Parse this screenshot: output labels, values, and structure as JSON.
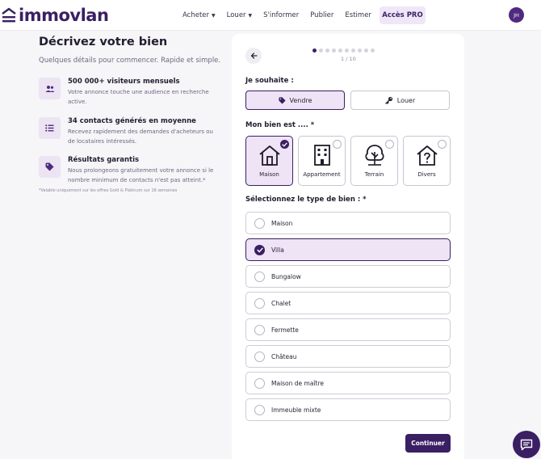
{
  "header": {
    "logo_text": "immovlan",
    "nav": [
      {
        "label": "Acheter",
        "has_dropdown": true
      },
      {
        "label": "Louer",
        "has_dropdown": true
      },
      {
        "label": "S'informer",
        "has_dropdown": false
      },
      {
        "label": "Publier",
        "has_dropdown": false
      },
      {
        "label": "Estimer",
        "has_dropdown": false
      }
    ],
    "pro_label": "Accès PRO",
    "avatar_initials": "JH"
  },
  "intro": {
    "title": "Décrivez votre bien",
    "subtitle": "Quelques détails pour commencer. Rapide et simple.",
    "features": [
      {
        "icon": "users-icon",
        "title": "500 000+ visiteurs mensuels",
        "desc": "Votre annonce touche une audience en recherche active."
      },
      {
        "icon": "list-icon",
        "title": "34 contacts générés en moyenne",
        "desc": "Recevez rapidement des demandes d'acheteurs ou de locataires intéressés."
      },
      {
        "icon": "tag-icon",
        "title": "Résultats garantis",
        "desc": "Nous prolongeons gratuitement votre annonce si le nombre minimum de contacts n'est pas atteint.*"
      }
    ],
    "footnote": "*Valable uniquement sur les offres Gold & Platinum sur 16 semaines"
  },
  "form": {
    "progress": {
      "current": 1,
      "total": 10,
      "text": "1 / 10"
    },
    "intent_label": "Je souhaite :",
    "intent_options": [
      {
        "label": "Vendre",
        "icon": "tag-icon",
        "selected": true
      },
      {
        "label": "Louer",
        "icon": "key-icon",
        "selected": false
      }
    ],
    "property_label": "Mon bien est .... *",
    "property_types": [
      {
        "label": "Maison",
        "icon": "house-icon",
        "selected": true
      },
      {
        "label": "Appartement",
        "icon": "building-icon",
        "selected": false
      },
      {
        "label": "Terrain",
        "icon": "trees-icon",
        "selected": false
      },
      {
        "label": "Divers",
        "icon": "question-house-icon",
        "selected": false
      }
    ],
    "subtype_label": "Sélectionnez le type de bien : *",
    "subtypes": [
      {
        "label": "Maison",
        "selected": false
      },
      {
        "label": "Villa",
        "selected": true
      },
      {
        "label": "Bungalow",
        "selected": false
      },
      {
        "label": "Chalet",
        "selected": false
      },
      {
        "label": "Fermette",
        "selected": false
      },
      {
        "label": "Château",
        "selected": false
      },
      {
        "label": "Maison de maître",
        "selected": false
      },
      {
        "label": "Immeuble mixte",
        "selected": false
      }
    ],
    "continue_label": "Continuer"
  },
  "colors": {
    "brand": "#3b1f63",
    "selected_bg": "#efe3f6"
  }
}
